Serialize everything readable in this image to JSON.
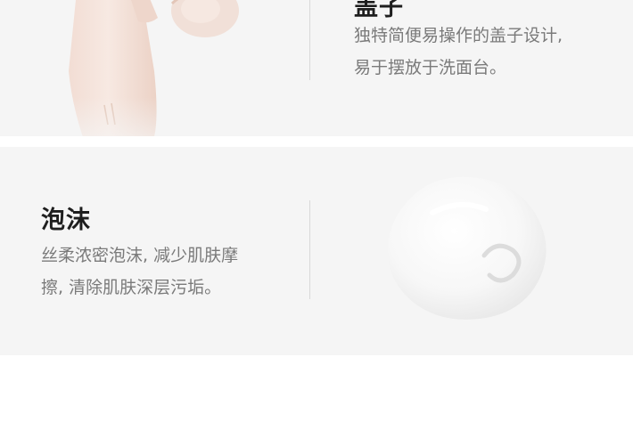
{
  "cap_section": {
    "title": "盖子",
    "lines": [
      "独特简便易操作的盖子设计,",
      "易于摆放于洗面台。"
    ]
  },
  "foam_section": {
    "title": "泡沫",
    "lines": [
      "丝柔浓密泡沫, 减少肌肤摩",
      "擦, 清除肌肤深层污垢。"
    ]
  },
  "colors": {
    "panel_bg": "#f5f5f5",
    "title_text": "#1e1e1e",
    "body_text": "#7a7a7a",
    "divider": "#d9d9d9"
  }
}
